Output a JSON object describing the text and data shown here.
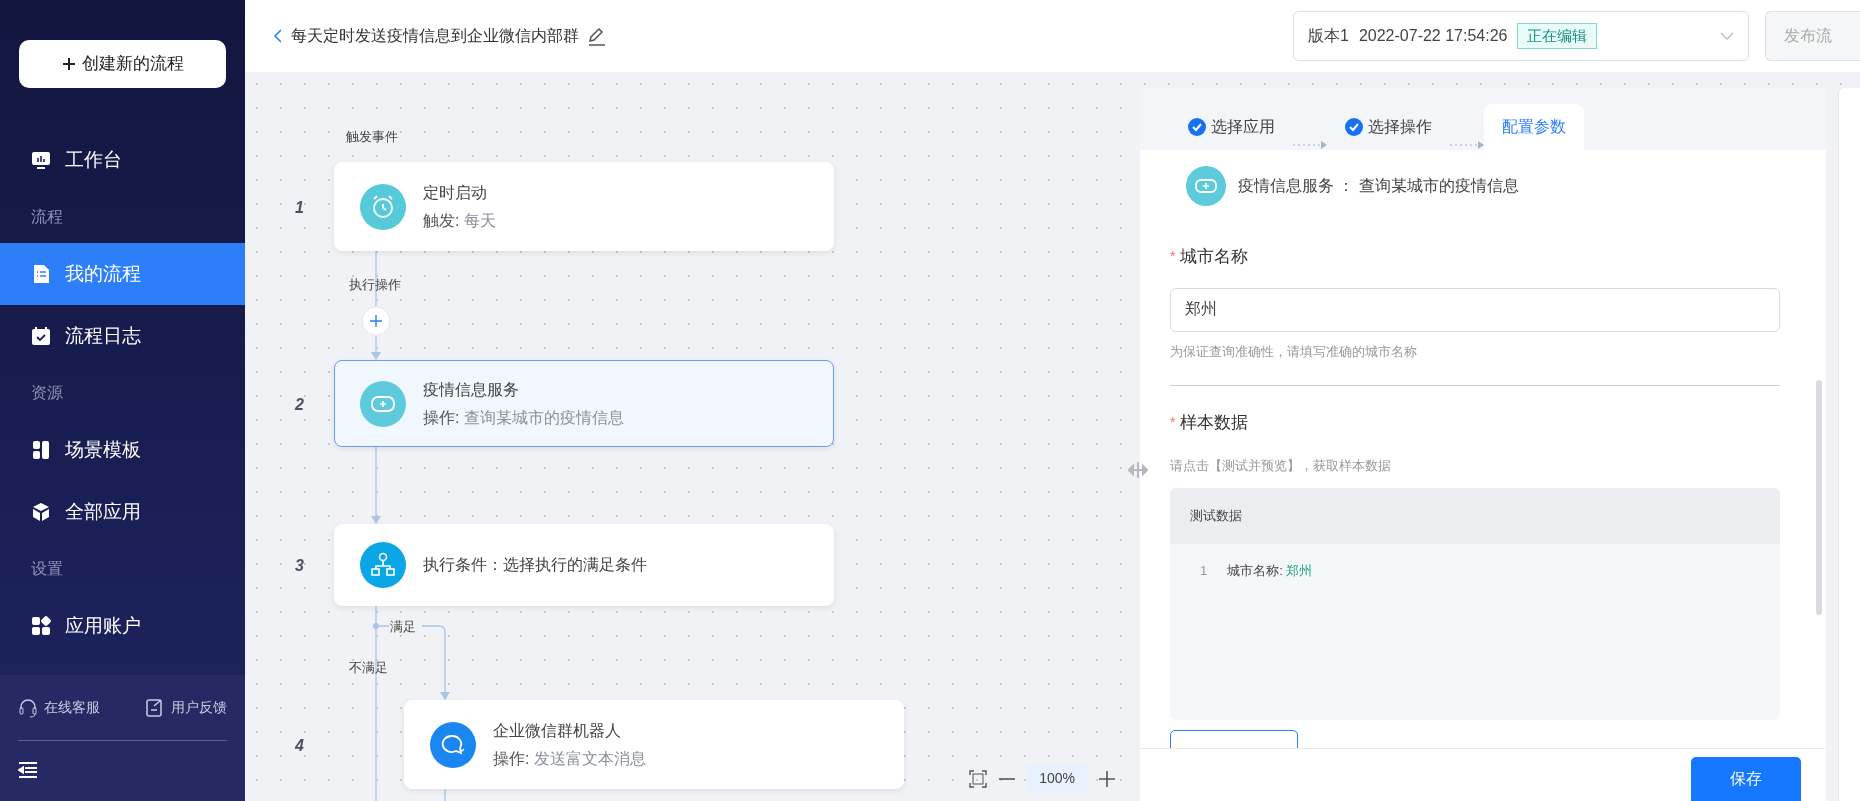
{
  "sidebar": {
    "create_button": "创建新的流程",
    "items": [
      {
        "kind": "item",
        "label": "工作台",
        "selected": false
      },
      {
        "kind": "section",
        "label": "流程"
      },
      {
        "kind": "item",
        "label": "我的流程",
        "selected": true
      },
      {
        "kind": "item",
        "label": "流程日志",
        "selected": false
      },
      {
        "kind": "section",
        "label": "资源"
      },
      {
        "kind": "item",
        "label": "场景模板",
        "selected": false
      },
      {
        "kind": "item",
        "label": "全部应用",
        "selected": false
      },
      {
        "kind": "section",
        "label": "设置"
      },
      {
        "kind": "item",
        "label": "应用账户",
        "selected": false
      }
    ],
    "footer_links": [
      "在线客服",
      "用户反馈"
    ]
  },
  "header": {
    "title": "每天定时发送疫情信息到企业微信内部群",
    "version": "版本1",
    "time": "2022-07-22 17:54:26",
    "badge": "正在编辑",
    "publish_button": "发布流"
  },
  "canvas": {
    "trigger_label": "触发事件",
    "action_label": "执行操作",
    "nodes": [
      {
        "number": "1",
        "title": "定时启动",
        "sub_label": "触发:",
        "sub_value": "每天",
        "color": "#56cad9",
        "selected": false
      },
      {
        "number": "2",
        "title": "疫情信息服务",
        "sub_label": "操作:",
        "sub_value": "查询某城市的疫情信息",
        "color": "#5ecbdc",
        "selected": true
      },
      {
        "number": "3",
        "title": "执行条件：选择执行的满足条件",
        "color": "#0ba6e6",
        "selected": false
      },
      {
        "number": "4",
        "title": "企业微信群机器人",
        "sub_label": "操作:",
        "sub_value": "发送富文本消息",
        "color": "#1a86f0",
        "selected": false
      }
    ],
    "branch_yes": "满足",
    "branch_no": "不满足",
    "zoom": "100%"
  },
  "panel": {
    "steps": [
      {
        "label": "选择应用",
        "done": true,
        "selected": false
      },
      {
        "label": "选择操作",
        "done": true,
        "selected": false
      },
      {
        "label": "配置参数",
        "done": false,
        "selected": true
      }
    ],
    "app": "疫情信息服务",
    "separator": "：",
    "operation": "查询某城市的疫情信息",
    "city": {
      "label": "城市名称",
      "required": true,
      "required_mark": "*",
      "value": "郑州",
      "hint": "为保证查询准确性，请填写准确的城市名称"
    },
    "sample": {
      "label": "样本数据",
      "required": true,
      "required_mark": "*",
      "hint": "请点击【测试并预览】，获取样本数据",
      "table_header": "测试数据",
      "rows": [
        {
          "index": "1",
          "key": "城市名称:",
          "value": "郑州"
        }
      ]
    },
    "save_button": "保存"
  }
}
